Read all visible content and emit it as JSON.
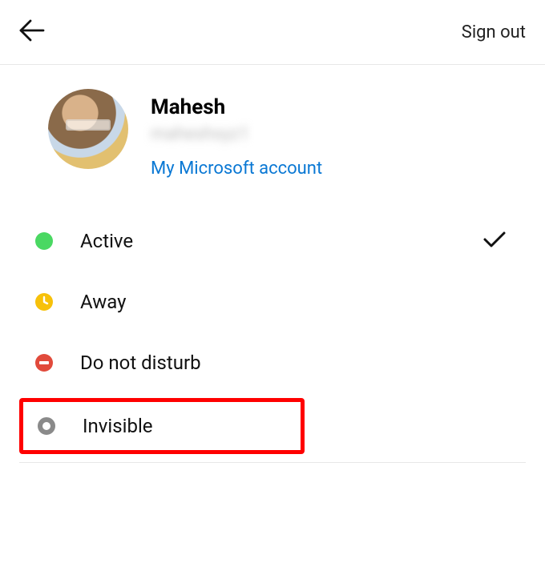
{
  "header": {
    "signout_label": "Sign out"
  },
  "profile": {
    "name": "Mahesh",
    "username_blurred": "maheshxyz1",
    "account_link_label": "My Microsoft account"
  },
  "statuses": [
    {
      "key": "active",
      "label": "Active",
      "icon": "green-dot",
      "selected": true
    },
    {
      "key": "away",
      "label": "Away",
      "icon": "away-clock",
      "selected": false
    },
    {
      "key": "dnd",
      "label": "Do not disturb",
      "icon": "dnd",
      "selected": false
    },
    {
      "key": "invis",
      "label": "Invisible",
      "icon": "gray-ring",
      "selected": false
    }
  ],
  "icons": {
    "back": "back-arrow",
    "check": "checkmark"
  },
  "highlight_status_key": "invis"
}
